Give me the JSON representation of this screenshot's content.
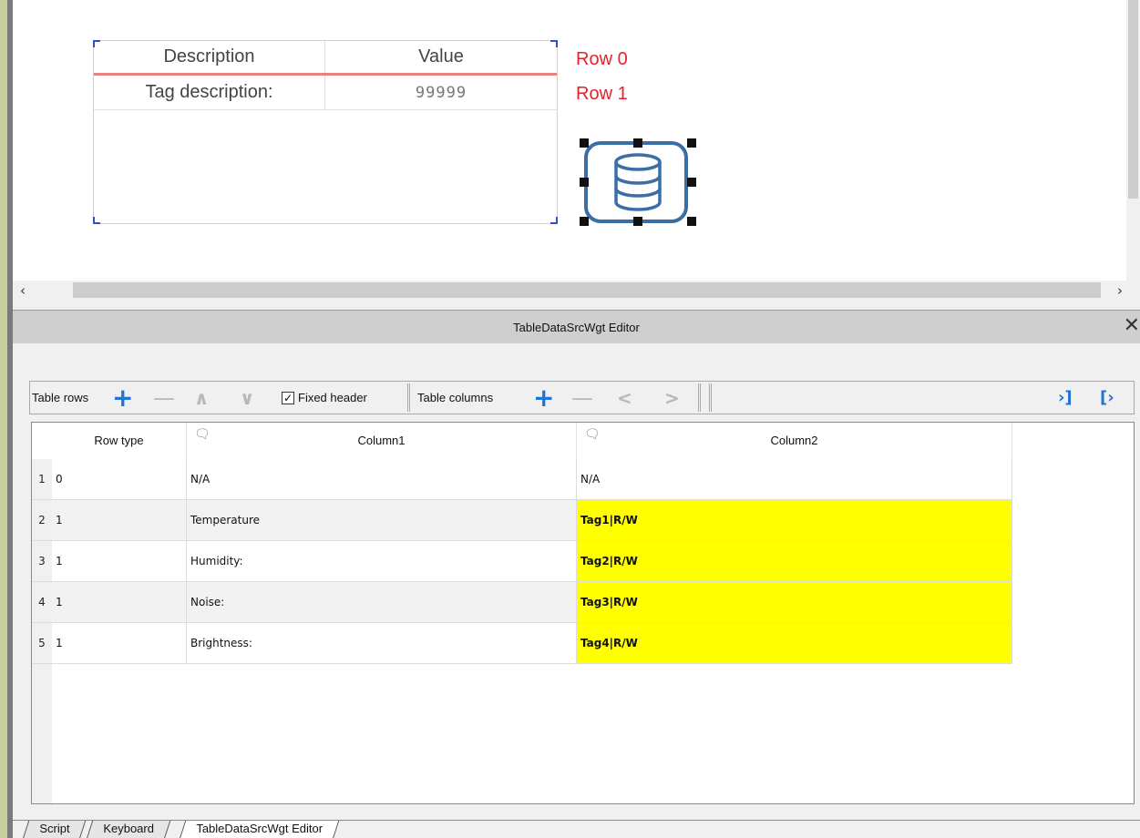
{
  "canvas": {
    "preview_table": {
      "headers": [
        "Description",
        "Value"
      ],
      "row": [
        "Tag description:",
        "99999"
      ]
    },
    "row_labels": [
      "Row 0",
      "Row 1"
    ],
    "datasource_icon": "database-icon"
  },
  "editor": {
    "title": "TableDataSrcWgt Editor",
    "close_icon": "close-icon",
    "toolbar": {
      "table_rows_label": "Table rows",
      "fixed_header_label": "Fixed header",
      "fixed_header_checked": true,
      "table_columns_label": "Table columns"
    },
    "grid": {
      "headers": [
        "Row type",
        "Column1",
        "Column2"
      ],
      "rows": [
        {
          "num": "1",
          "row_type": "0",
          "col1": "N/A",
          "col2": "N/A",
          "tag": false
        },
        {
          "num": "2",
          "row_type": "1",
          "col1": "Temperature",
          "col2": "Tag1|R/W",
          "tag": true
        },
        {
          "num": "3",
          "row_type": "1",
          "col1": "Humidity:",
          "col2": "Tag2|R/W",
          "tag": true
        },
        {
          "num": "4",
          "row_type": "1",
          "col1": "Noise:",
          "col2": "Tag3|R/W",
          "tag": true
        },
        {
          "num": "5",
          "row_type": "1",
          "col1": "Brightness:",
          "col2": "Tag4|R/W",
          "tag": true
        }
      ],
      "tag_highlight_color": "#ffff00"
    }
  },
  "tabs": [
    "Script",
    "Keyboard",
    "TableDataSrcWgt Editor"
  ],
  "active_tab": "TableDataSrcWgt Editor",
  "colors": {
    "row_label": "#e8202a",
    "accent_blue": "#1e73d8",
    "widget_blue": "#3a6ea5"
  }
}
